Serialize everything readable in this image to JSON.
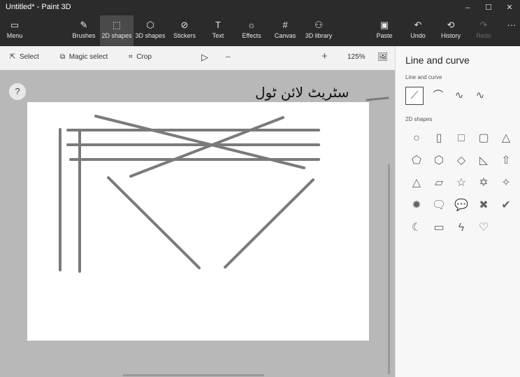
{
  "window": {
    "title": "Untitled* - Paint 3D",
    "minimize_icon": "–",
    "maximize_icon": "☐",
    "close_icon": "✕"
  },
  "ribbon": {
    "menu": "Menu",
    "brushes": "Brushes",
    "shapes2d": "2D shapes",
    "shapes3d": "3D shapes",
    "stickers": "Stickers",
    "text": "Text",
    "effects": "Effects",
    "canvas": "Canvas",
    "library": "3D library",
    "paste": "Paste",
    "undo": "Undo",
    "history": "History",
    "redo": "Redo",
    "more": "···"
  },
  "toolbar": {
    "select": "Select",
    "magic_select": "Magic select",
    "crop": "Crop",
    "zoom": "125%",
    "zoom_minus": "−",
    "zoom_plus": "+"
  },
  "zoom_level": 0.55,
  "help": "?",
  "panel": {
    "title": "Line and curve",
    "section_lines": "Line and curve",
    "section_shapes": "2D shapes",
    "shapes": [
      [
        "circle-icon",
        "○"
      ],
      [
        "capsule-icon",
        "▯"
      ],
      [
        "square-icon",
        "□"
      ],
      [
        "rounded-square-icon",
        "▢"
      ],
      [
        "triangle-icon",
        "△"
      ],
      [
        "pentagon-icon",
        "⬠"
      ],
      [
        "hexagon-icon",
        "⬡"
      ],
      [
        "diamond-icon",
        "◇"
      ],
      [
        "right-triangle-icon",
        "◺"
      ],
      [
        "arrow-up-icon",
        "⇧"
      ],
      [
        "chevron-triangle-icon",
        "△"
      ],
      [
        "leaf-icon",
        "▱"
      ],
      [
        "star5-icon",
        "☆"
      ],
      [
        "star6-icon",
        "✡"
      ],
      [
        "star4-icon",
        "✧"
      ],
      [
        "burst-icon",
        "✹"
      ],
      [
        "speech-rect-icon",
        "🗨"
      ],
      [
        "speech-oval-icon",
        "💬"
      ],
      [
        "cross-icon",
        "✖"
      ],
      [
        "check-icon",
        "✔"
      ],
      [
        "moon-icon",
        "☾"
      ],
      [
        "banner-icon",
        "▭"
      ],
      [
        "lightning-icon",
        "ϟ"
      ],
      [
        "heart-icon",
        "♡"
      ]
    ]
  },
  "annotation": "سٹریٹ لائن ٹول"
}
